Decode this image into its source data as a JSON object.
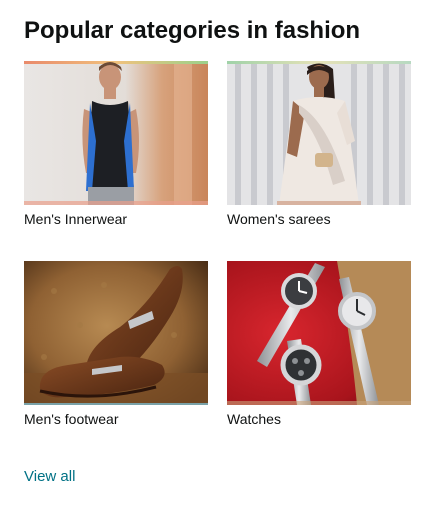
{
  "card": {
    "title": "Popular categories in fashion",
    "view_all": "View all"
  },
  "tiles": [
    {
      "label": "Men's Innerwear",
      "image": "man-in-vest-photo"
    },
    {
      "label": "Women's sarees",
      "image": "woman-in-saree-photo"
    },
    {
      "label": "Men's footwear",
      "image": "brown-loafers-photo"
    },
    {
      "label": "Watches",
      "image": "wristwatches-photo"
    }
  ],
  "colors": {
    "link": "#007185",
    "text": "#0f1111"
  }
}
